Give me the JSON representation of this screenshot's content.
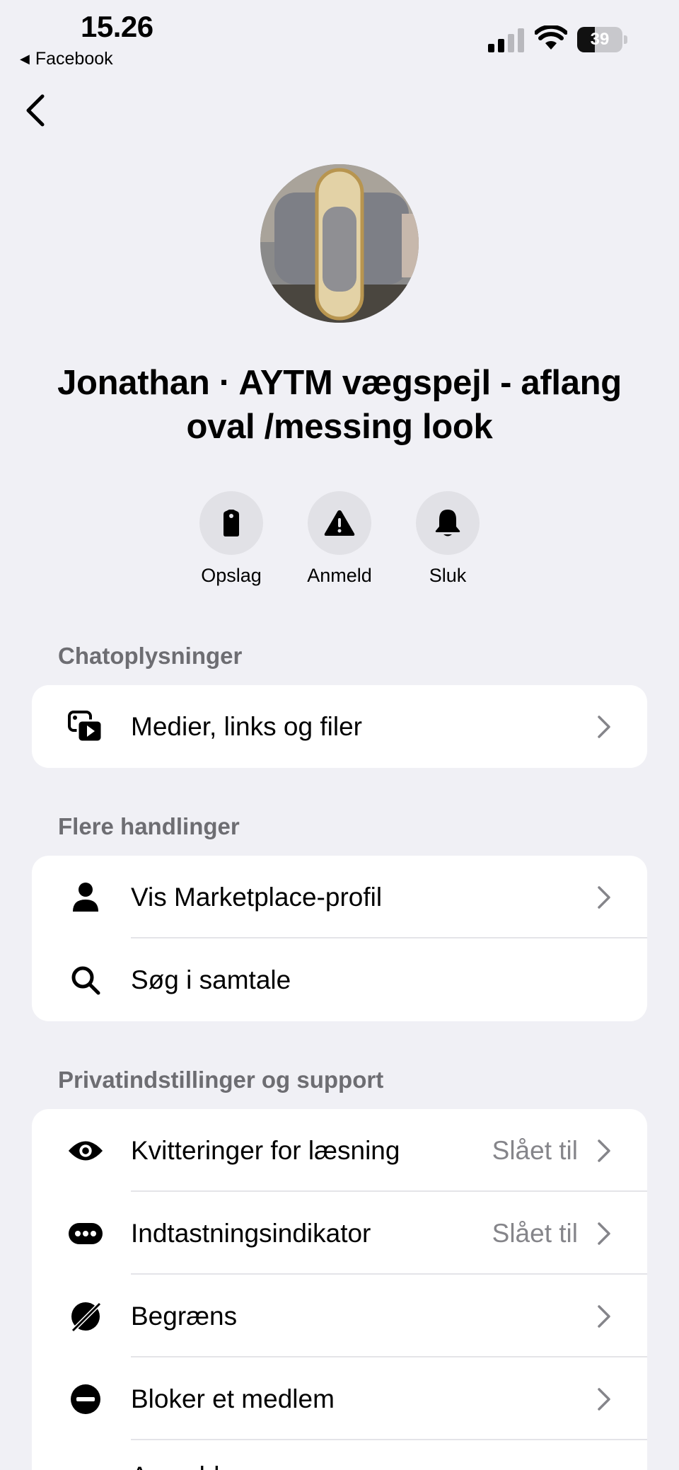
{
  "status_bar": {
    "time": "15.26",
    "back_app": "Facebook",
    "battery": "39",
    "battery_level": 0.39,
    "icons": [
      "cellular-signal-icon",
      "wifi-icon",
      "battery-icon"
    ]
  },
  "nav": {
    "back_icon": "chevron-left-icon"
  },
  "header": {
    "avatar": "product-photo-oval-mirror",
    "title": "Jonathan · AYTM vægspejl - aflang oval /messing look"
  },
  "quick_actions": [
    {
      "label": "Opslag",
      "icon": "tag-icon"
    },
    {
      "label": "Anmeld",
      "icon": "warning-icon"
    },
    {
      "label": "Sluk",
      "icon": "bell-icon"
    }
  ],
  "sections": {
    "chat_info": {
      "title": "Chatoplysninger",
      "items": [
        {
          "label": "Medier, links og filer",
          "icon": "media-icon"
        }
      ]
    },
    "more_actions": {
      "title": "Flere handlinger",
      "items": [
        {
          "label": "Vis Marketplace-profil",
          "icon": "person-icon"
        },
        {
          "label": "Søg i samtale",
          "icon": "search-icon"
        }
      ]
    },
    "privacy": {
      "title": "Privatindstillinger og support",
      "items": [
        {
          "label": "Kvitteringer for læsning",
          "value": "Slået til",
          "icon": "eye-icon"
        },
        {
          "label": "Indtastningsindikator",
          "value": "Slået til",
          "icon": "typing-bubble-icon"
        },
        {
          "label": "Begræns",
          "icon": "restrict-icon"
        },
        {
          "label": "Bloker et medlem",
          "icon": "block-icon"
        },
        {
          "label": "Anmeld",
          "icon": "report-icon"
        }
      ]
    }
  },
  "colors": {
    "background": "#f0f0f5",
    "card": "#ffffff",
    "section_label": "#6d6d72",
    "secondary_value": "#85858a",
    "action_circle": "#e1e1e6"
  }
}
